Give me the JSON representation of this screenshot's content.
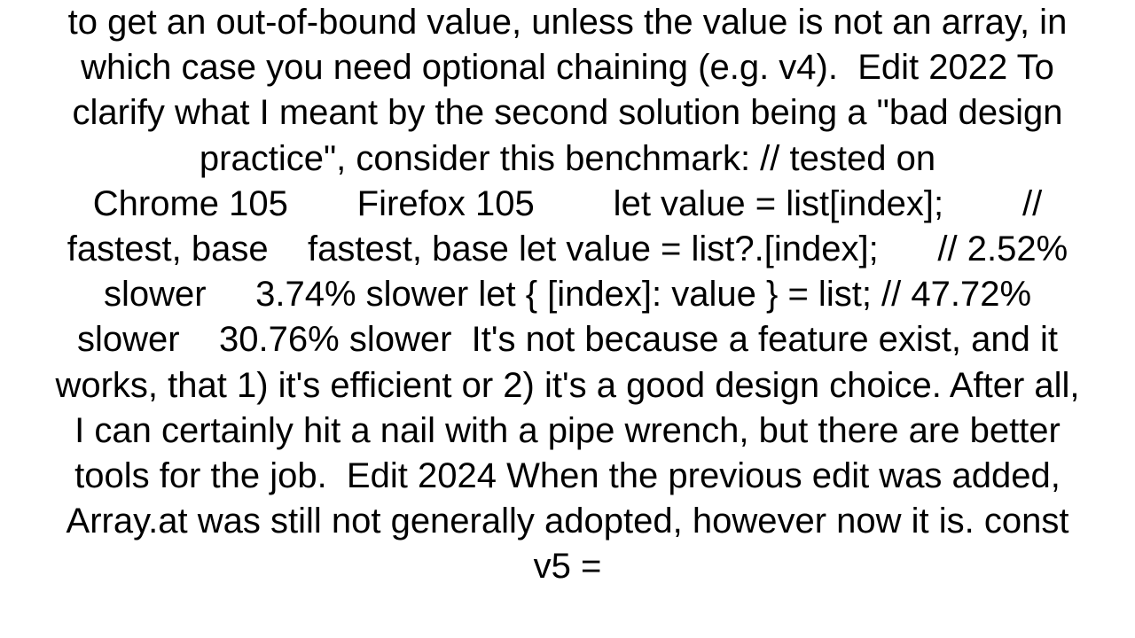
{
  "body": {
    "text": "to get an out-of-bound value, unless the value is not an array, in which case you need optional chaining (e.g. v4).  Edit 2022 To clarify what I meant by the second solution being a \"bad design practice\", consider this benchmark: // tested on                           Chrome 105       Firefox 105        let value = list[index];        // fastest, base    fastest, base let value = list?.[index];      // 2.52% slower     3.74% slower let { [index]: value } = list; // 47.72% slower    30.76% slower  It's not because a feature exist, and it works, that 1) it's efficient or 2) it's a good design choice. After all, I can certainly hit a nail with a pipe wrench, but there are better tools for the job.  Edit 2024 When the previous edit was added, Array.at was still not generally adopted, however now it is. const v5 ="
  }
}
